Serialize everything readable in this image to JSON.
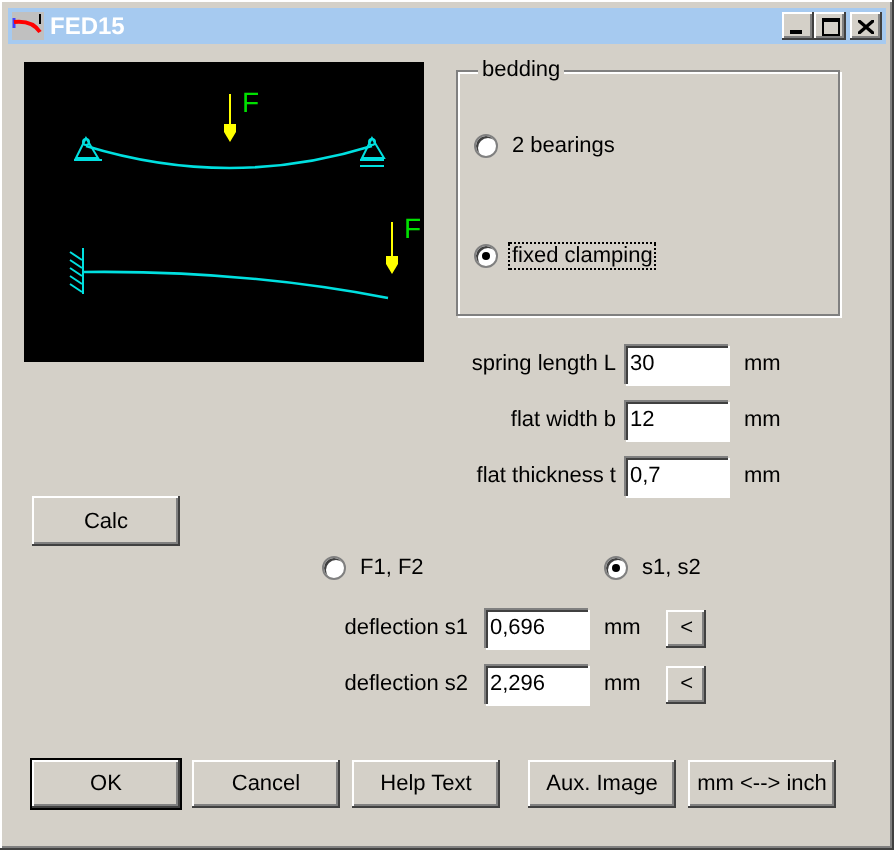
{
  "window": {
    "title": "FED15"
  },
  "diagram": {
    "force_labels": [
      "F",
      "F"
    ]
  },
  "bedding": {
    "title": "bedding",
    "options": [
      {
        "label": "2 bearings",
        "selected": false,
        "focused": false
      },
      {
        "label": "fixed clamping",
        "selected": true,
        "focused": true
      }
    ]
  },
  "inputs": [
    {
      "label": "spring length L",
      "value": "30",
      "unit": "mm"
    },
    {
      "label": "flat width b",
      "value": "12",
      "unit": "mm"
    },
    {
      "label": "flat thickness t",
      "value": "0,7",
      "unit": "mm"
    }
  ],
  "calc_button": "Calc",
  "output_mode": [
    {
      "label": "F1, F2",
      "selected": false
    },
    {
      "label": "s1, s2",
      "selected": true
    }
  ],
  "results": [
    {
      "label": "deflection s1",
      "value": "0,696",
      "unit": "mm",
      "button": "<"
    },
    {
      "label": "deflection s2",
      "value": "2,296",
      "unit": "mm",
      "button": "<"
    }
  ],
  "buttons": [
    {
      "label": "OK",
      "default": true
    },
    {
      "label": "Cancel",
      "default": false
    },
    {
      "label": "Help Text",
      "default": false
    },
    {
      "label": "Aux. Image",
      "default": false
    },
    {
      "label": "mm <--> inch",
      "default": false
    }
  ]
}
